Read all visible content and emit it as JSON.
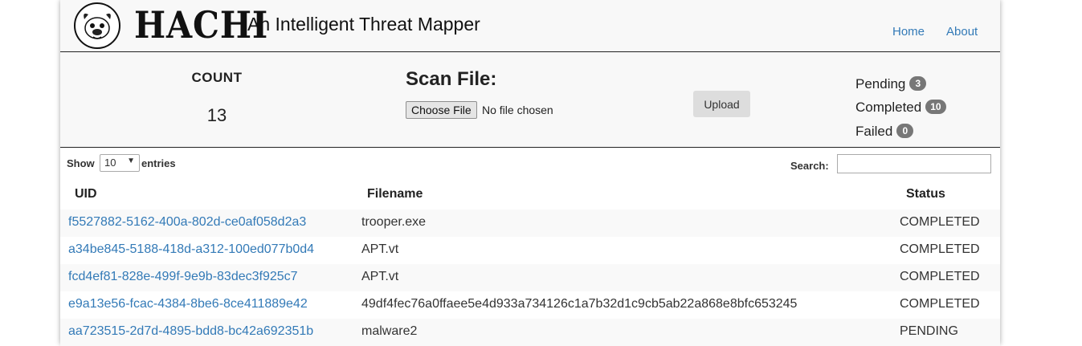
{
  "header": {
    "logo_text": "HACHI",
    "tagline": "An Intelligent Threat Mapper",
    "nav": [
      {
        "label": "Home"
      },
      {
        "label": "About"
      }
    ]
  },
  "stats": {
    "count_label": "COUNT",
    "count_value": "13",
    "statuses": [
      {
        "label": "Pending",
        "count": "3"
      },
      {
        "label": "Completed",
        "count": "10"
      },
      {
        "label": "Failed",
        "count": "0"
      }
    ]
  },
  "scan": {
    "title": "Scan File:",
    "choose_label": "Choose File",
    "file_status": "No file chosen",
    "upload_label": "Upload"
  },
  "table_controls": {
    "show_label": "Show",
    "entries_value": "10",
    "entries_label": "entries",
    "search_label": "Search:",
    "search_value": ""
  },
  "table": {
    "columns": [
      "UID",
      "Filename",
      "Status"
    ],
    "rows": [
      {
        "uid": "f5527882-5162-400a-802d-ce0af058d2a3",
        "filename": "trooper.exe",
        "status": "COMPLETED"
      },
      {
        "uid": "a34be845-5188-418d-a312-100ed077b0d4",
        "filename": "APT.vt",
        "status": "COMPLETED"
      },
      {
        "uid": "fcd4ef81-828e-499f-9e9b-83dec3f925c7",
        "filename": "APT.vt",
        "status": "COMPLETED"
      },
      {
        "uid": "e9a13e56-fcac-4384-8be6-8ce411889e42",
        "filename": "49df4fec76a0ffaee5e4d933a734126c1a7b32d1c9cb5ab22a868e8bfc653245",
        "status": "COMPLETED"
      },
      {
        "uid": "aa723515-2d7d-4895-bdd8-bc42a692351b",
        "filename": "malware2",
        "status": "PENDING"
      }
    ]
  },
  "colors": {
    "link": "#337ab7",
    "badge": "#777777",
    "panel_bg": "#f8f8f8"
  }
}
